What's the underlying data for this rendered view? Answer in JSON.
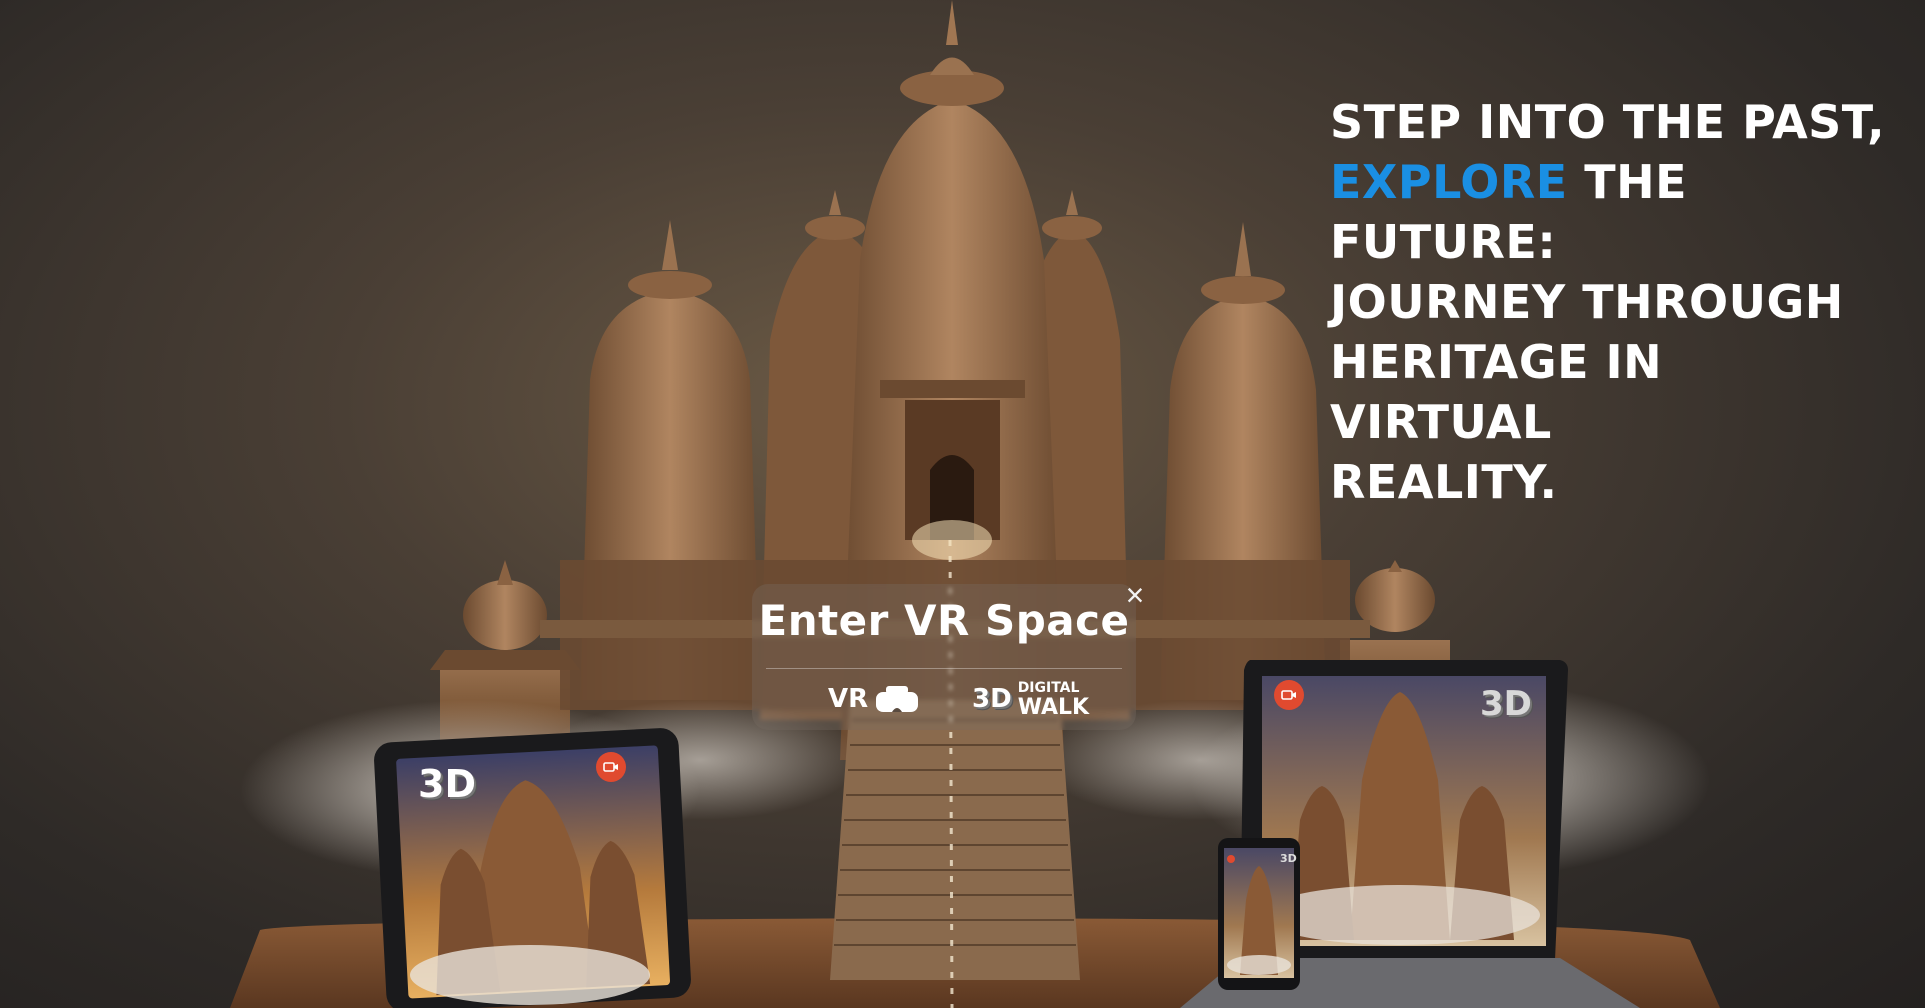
{
  "headline": {
    "line1": "STEP INTO THE PAST,",
    "accent": "EXPLORE",
    "line2_rest": " THE FUTURE:",
    "line3": "JOURNEY THROUGH",
    "line4": "HERITAGE IN VIRTUAL",
    "line5": "REALITY."
  },
  "vr_modal": {
    "title": "Enter VR Space",
    "close": "×",
    "vr_label": "VR",
    "walk_top": "DIGITAL",
    "walk_bottom": "WALK",
    "walk_badge": "3D"
  },
  "devices": {
    "tablet_badge": "3D",
    "laptop_badge": "3D",
    "phone_badge": "3D"
  },
  "colors": {
    "accent": "#1a8fe3",
    "record": "#e04a2f",
    "text": "#ffffff"
  },
  "icons": [
    "vr-headset-icon",
    "video-record-icon",
    "close-icon",
    "3d-cube-icon"
  ]
}
